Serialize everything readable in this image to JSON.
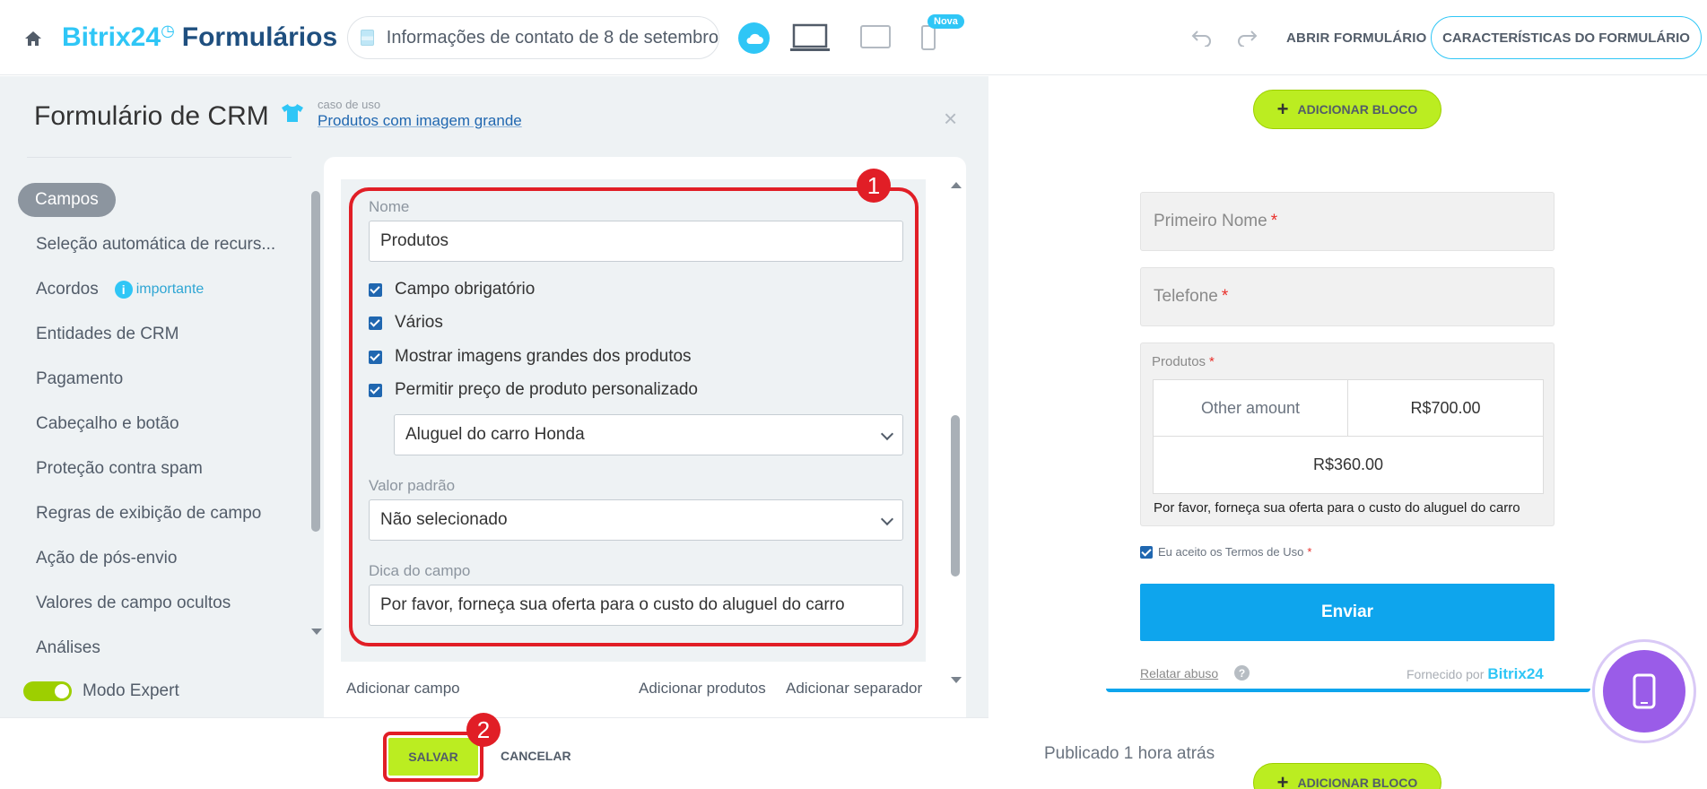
{
  "header": {
    "brand_b24": "Bitrix24",
    "brand_forms": "Formulários",
    "form_name": "Informações de contato de 8 de setembro",
    "new_badge": "Nova",
    "open_form": "ABRIR FORMULÁRIO",
    "form_features": "CARACTERÍSTICAS DO FORMULÁRIO"
  },
  "panel": {
    "title": "Formulário de CRM",
    "usecase_label": "caso de uso",
    "usecase_link": "Produtos com imagem grande",
    "close": "×"
  },
  "nav": {
    "items": [
      {
        "label": "Campos",
        "active": true
      },
      {
        "label": "Seleção automática de recurs..."
      },
      {
        "label": "Acordos",
        "badge": "importante"
      },
      {
        "label": "Entidades de CRM"
      },
      {
        "label": "Pagamento"
      },
      {
        "label": "Cabeçalho e botão"
      },
      {
        "label": "Proteção contra spam"
      },
      {
        "label": "Regras de exibição de campo"
      },
      {
        "label": "Ação de pós-envio"
      },
      {
        "label": "Valores de campo ocultos"
      },
      {
        "label": "Análises"
      }
    ],
    "expert_mode": "Modo Expert",
    "expert_mode_on": true
  },
  "field_editor": {
    "name_label": "Nome",
    "name_value": "Produtos",
    "checkboxes": [
      {
        "label": "Campo obrigatório",
        "checked": true
      },
      {
        "label": "Vários",
        "checked": true
      },
      {
        "label": "Mostrar imagens grandes dos produtos",
        "checked": true
      },
      {
        "label": "Permitir preço de produto personalizado",
        "checked": true
      }
    ],
    "custom_price_product": "Aluguel do carro Honda",
    "default_label": "Valor padrão",
    "default_value": "Não selecionado",
    "hint_label": "Dica do campo",
    "hint_value": "Por favor, forneça sua oferta para o custo do aluguel do carro",
    "marker_1": "1"
  },
  "add_links": {
    "add_field": "Adicionar campo",
    "add_products": "Adicionar produtos",
    "add_separator": "Adicionar separador"
  },
  "footer": {
    "save": "SALVAR",
    "cancel": "CANCELAR",
    "marker_2": "2"
  },
  "preview": {
    "add_block": "ADICIONAR BLOCO",
    "first_name": "Primeiro Nome",
    "phone": "Telefone",
    "required_mark": "*",
    "products_label": "Produtos",
    "product_options": [
      "Other amount",
      "R$700.00",
      "R$360.00"
    ],
    "products_hint": "Por favor, forneça sua oferta para o custo do aluguel do carro",
    "terms": "Eu aceito os Termos de Uso",
    "submit": "Enviar",
    "report_abuse": "Relatar abuso",
    "powered_by": "Fornecido por",
    "powered_brand": "Bitrix24",
    "published": "Publicado 1 hora atrás"
  },
  "colors": {
    "accent": "#2fc6f6",
    "highlight": "#e11e26",
    "save_green": "#bbed21",
    "submit_blue": "#0ea5ed",
    "fab_purple": "#9a5ce8"
  }
}
